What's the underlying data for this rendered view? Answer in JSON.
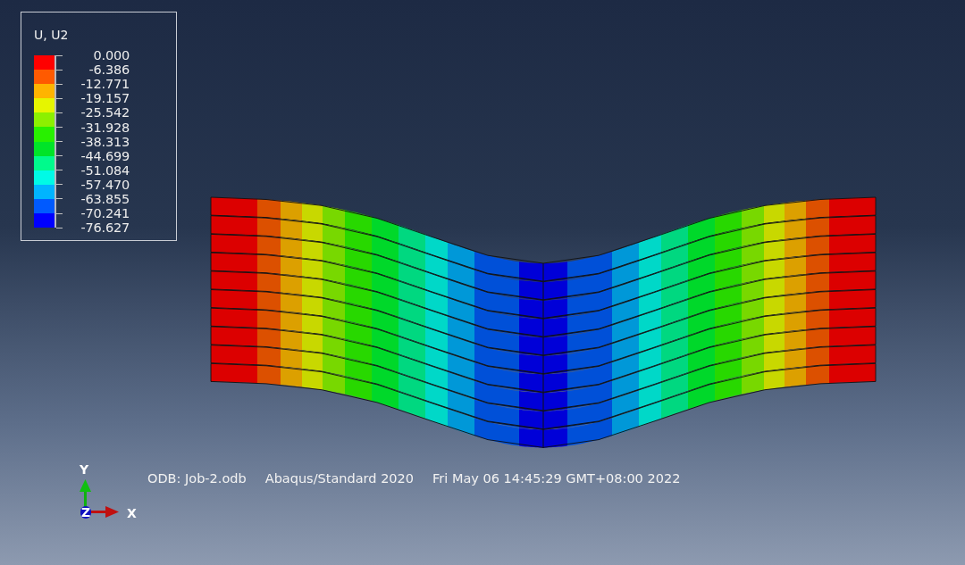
{
  "legend": {
    "title": "U, U2",
    "bands": [
      {
        "color": "#ff0000"
      },
      {
        "color": "#ff5a00"
      },
      {
        "color": "#ffb400"
      },
      {
        "color": "#e6f500"
      },
      {
        "color": "#8cf000"
      },
      {
        "color": "#28f000"
      },
      {
        "color": "#00e428"
      },
      {
        "color": "#00fa8c"
      },
      {
        "color": "#00fae6"
      },
      {
        "color": "#00b4ff"
      },
      {
        "color": "#005aff"
      },
      {
        "color": "#0000ff"
      }
    ],
    "values": [
      "0.000",
      "-6.386",
      "-12.771",
      "-19.157",
      "-25.542",
      "-31.928",
      "-38.313",
      "-44.699",
      "-51.084",
      "-57.470",
      "-63.855",
      "-70.241",
      "-76.627"
    ]
  },
  "triad": {
    "y_label": "Y",
    "x_label": "X",
    "z_label": "Z"
  },
  "info": [
    "ODB: Job-2.odb",
    "Abaqus/Standard 2020",
    "Fri May 06 14:45:29 GMT+08:00 2022"
  ]
}
